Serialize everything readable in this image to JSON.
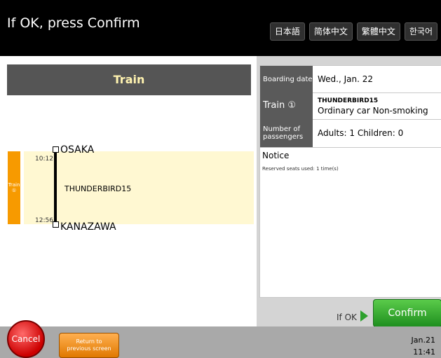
{
  "header": {
    "title": "If OK, press Confirm",
    "languages": [
      "日本語",
      "简体中文",
      "繁體中文",
      "한국어"
    ]
  },
  "left": {
    "title": "Train",
    "tag": {
      "line1": "Train",
      "line2": "①"
    },
    "departure": {
      "time": "10:12",
      "station": "OSAKA"
    },
    "arrival": {
      "time": "12:56",
      "station": "KANAZAWA"
    },
    "train_name": "THUNDERBIRD15"
  },
  "info": {
    "boarding_date_label": "Boarding date",
    "boarding_date_value": "Wed., Jan. 22",
    "train_label": "Train ①",
    "train_name": "THUNDERBIRD15",
    "car_type": "Ordinary car   Non-smoking",
    "passengers_label_1": "Number of",
    "passengers_label_2": "passengers",
    "passengers_value": "Adults: 1  Children: 0",
    "notice_label": "Notice",
    "notice_text": "Reserved seats used: 1 time(s)"
  },
  "actions": {
    "if_ok": "If OK",
    "confirm": "Confirm",
    "cancel": "Cancel",
    "return_1": "Return to",
    "return_2": "previous screen"
  },
  "footer": {
    "date": "Jan.21",
    "time": "11:41"
  },
  "colors": {
    "header": "#000000",
    "train_title_bg": "#555555",
    "train_title_text": "#fff3b0",
    "timeline_bg": "#fff8d2",
    "tag_orange": "#f79a00",
    "confirm_green": "#2ea12e",
    "cancel_red": "#cc0000",
    "return_orange": "#e07800",
    "footer_gray": "#a9a9a9"
  }
}
